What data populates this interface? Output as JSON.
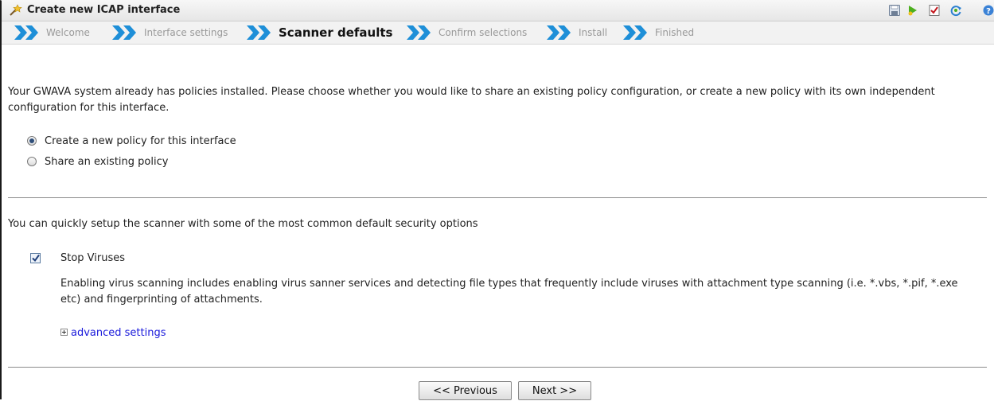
{
  "window": {
    "title": "Create new ICAP interface",
    "toolbar_icons": [
      "save-icon",
      "run-icon",
      "checklist-icon",
      "refresh-icon",
      "help-icon"
    ]
  },
  "steps": [
    {
      "label": "Welcome",
      "active": false
    },
    {
      "label": "Interface settings",
      "active": false
    },
    {
      "label": "Scanner defaults",
      "active": true
    },
    {
      "label": "Confirm selections",
      "active": false
    },
    {
      "label": "Install",
      "active": false
    },
    {
      "label": "Finished",
      "active": false
    }
  ],
  "policy_section": {
    "intro": "Your GWAVA system already has policies installed. Please choose whether you would like to share an existing policy configuration, or create a new policy with its own independent configuration for this interface.",
    "options": [
      {
        "label": "Create a new policy for this interface",
        "selected": true
      },
      {
        "label": "Share an existing policy",
        "selected": false
      }
    ]
  },
  "scanner_section": {
    "intro": "You can quickly setup the scanner with some of the most common default security options",
    "stop_viruses": {
      "label": "Stop Viruses",
      "checked": true,
      "description": "Enabling virus scanning includes enabling virus sanner services and detecting file types that frequently include viruses with attachment type scanning (i.e. *.vbs, *.pif, *.exe etc) and fingerprinting of attachments."
    },
    "advanced_link": "advanced settings"
  },
  "buttons": {
    "previous": "<< Previous",
    "next": "Next >>"
  },
  "colors": {
    "chevron": "#1e8fd8",
    "link": "#1a1adb",
    "active_step": "#111111",
    "inactive_step": "#999999"
  }
}
